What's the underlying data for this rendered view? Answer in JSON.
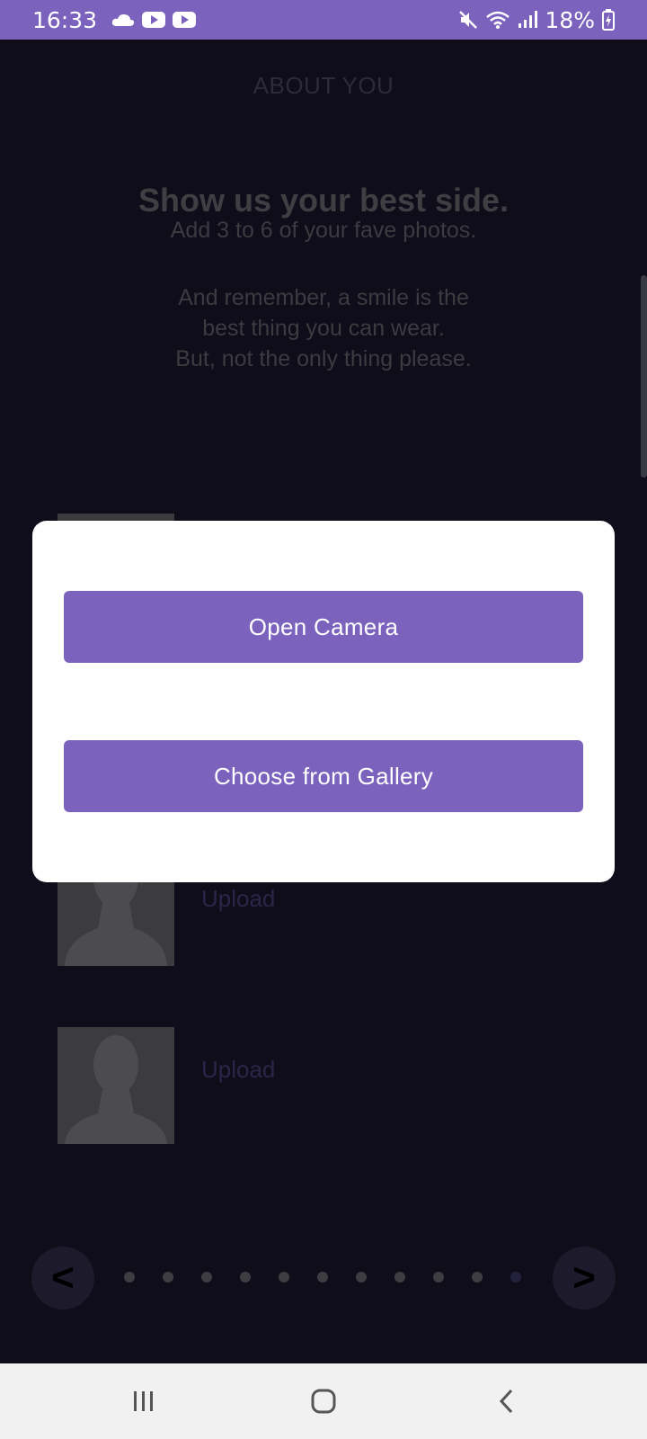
{
  "status_bar": {
    "time": "16:33",
    "left_icons": [
      "cloud-icon",
      "youtube-icon",
      "youtube-icon"
    ],
    "battery": "18%",
    "right_icons": [
      "mute-icon",
      "wifi-icon",
      "signal-icon",
      "battery-charging-icon"
    ]
  },
  "page": {
    "section_title": "ABOUT YOU",
    "headline": "Show us your best side.",
    "subline": "Add 3 to 6 of your fave photos.",
    "note_lines": [
      "And remember, a smile is the",
      "best thing you can wear.",
      "But, not the only thing please."
    ],
    "photo_slots": [
      {
        "upload_label": "Upload"
      },
      {
        "upload_label": "Upload"
      }
    ]
  },
  "pager": {
    "prev_label": "<",
    "next_label": ">",
    "dot_count": 11,
    "active_dot": 10
  },
  "dialog": {
    "open_camera_label": "Open Camera",
    "gallery_label": "Choose from Gallery"
  },
  "system_nav": {
    "recents": "recents-icon",
    "home": "home-icon",
    "back": "back-icon"
  },
  "colors": {
    "accent": "#7b62bd",
    "background": "#100d1b",
    "dialog": "#ffffff",
    "nav_bar": "#f1f1f1"
  }
}
